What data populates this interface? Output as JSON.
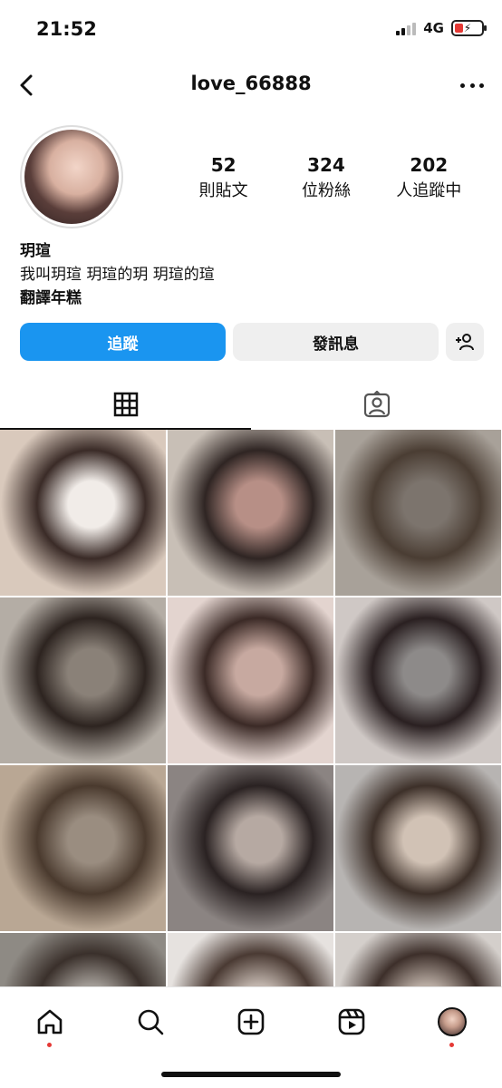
{
  "status_bar": {
    "time": "21:52",
    "network": "4G",
    "battery_icon": "battery-charging-low-icon"
  },
  "header": {
    "username": "love_66888"
  },
  "profile": {
    "posts_count": "52",
    "posts_label": "則貼文",
    "followers_count": "324",
    "followers_label": "位粉絲",
    "following_count": "202",
    "following_label": "人追蹤中",
    "display_name": "玥瑄",
    "bio": "我叫玥瑄 玥瑄的玥 玥瑄的瑄",
    "translate_label": "翻譯年糕"
  },
  "actions": {
    "follow_label": "追蹤",
    "message_label": "發訊息"
  },
  "tabs": [
    {
      "icon": "grid-icon",
      "active": true
    },
    {
      "icon": "tagged-person-icon",
      "active": false
    }
  ],
  "grid": [
    {
      "colors": [
        "#d9c9bc",
        "#3a2b27",
        "#f1ece8"
      ]
    },
    {
      "colors": [
        "#c8bfb6",
        "#2f2523",
        "#b78f86"
      ]
    },
    {
      "colors": [
        "#a8a199",
        "#4a3d33",
        "#7c746d"
      ]
    },
    {
      "colors": [
        "#b4ada5",
        "#2d2420",
        "#8a8178"
      ]
    },
    {
      "colors": [
        "#e3d4cf",
        "#3b2a26",
        "#c7a9a0"
      ]
    },
    {
      "colors": [
        "#cfc8c5",
        "#2a2021",
        "#8d8a89"
      ]
    },
    {
      "colors": [
        "#b9a794",
        "#4a3a2e",
        "#9a8d80"
      ]
    },
    {
      "colors": [
        "#8b8482",
        "#2a2222",
        "#b6a9a2"
      ]
    },
    {
      "colors": [
        "#b7b4b2",
        "#3d3029",
        "#d1c2b5"
      ]
    },
    {
      "colors": [
        "#8e8a84",
        "#3a302b",
        "#a09a94"
      ]
    },
    {
      "colors": [
        "#e6e2df",
        "#4a3a33",
        "#bfb3ab"
      ]
    },
    {
      "colors": [
        "#d4cfcb",
        "#3d2f2a",
        "#b7aaa1"
      ]
    }
  ],
  "nav": {
    "items": [
      "home-icon",
      "search-icon",
      "create-icon",
      "reels-icon",
      "profile-avatar"
    ],
    "active": "profile-avatar"
  },
  "colors": {
    "accent": "#1a95f0",
    "notification_dot": "#e53935"
  }
}
